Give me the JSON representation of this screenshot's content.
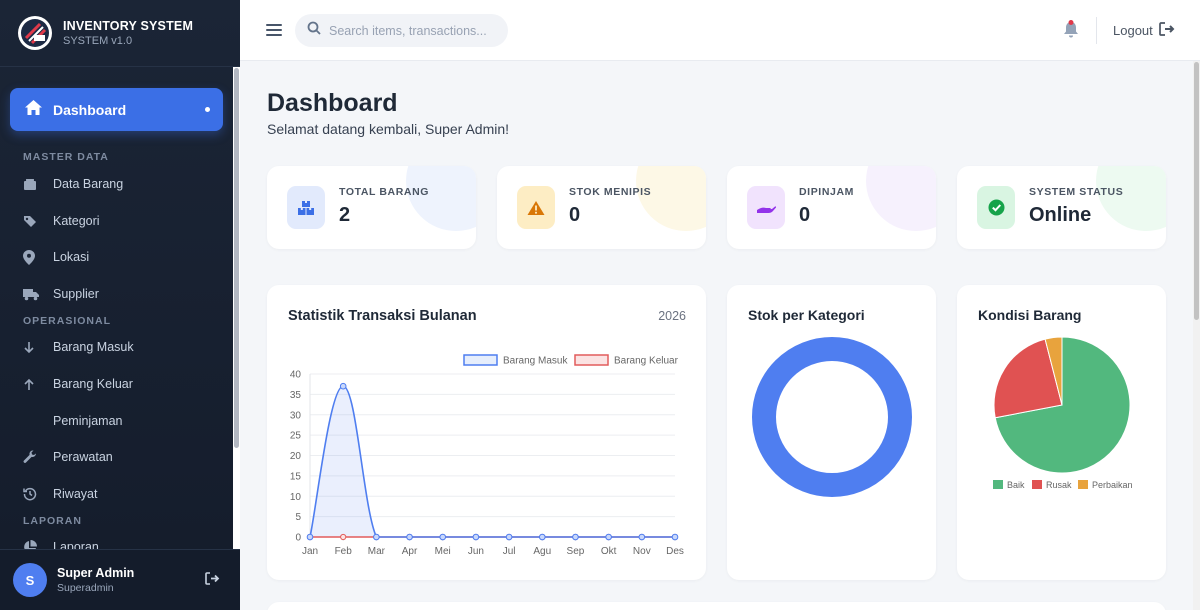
{
  "brand": {
    "title": "INVENTORY SYSTEM",
    "subtitle": "SYSTEM v1.0"
  },
  "sidebar": {
    "active": {
      "label": "Dashboard",
      "icon": "home-icon"
    },
    "sections": [
      {
        "title": "MASTER DATA"
      },
      {
        "title": "OPERASIONAL"
      },
      {
        "title": "LAPORAN"
      }
    ],
    "items": [
      {
        "label": "Data Barang",
        "icon": "box-icon"
      },
      {
        "label": "Kategori",
        "icon": "tags-icon"
      },
      {
        "label": "Lokasi",
        "icon": "map-pin-icon"
      },
      {
        "label": "Supplier",
        "icon": "truck-icon"
      },
      {
        "label": "Barang Masuk",
        "icon": "arrow-down-icon"
      },
      {
        "label": "Barang Keluar",
        "icon": "arrow-up-icon"
      },
      {
        "label": "Peminjaman",
        "icon": "handshake-icon"
      },
      {
        "label": "Perawatan",
        "icon": "wrench-icon"
      },
      {
        "label": "Riwayat",
        "icon": "history-icon"
      },
      {
        "label": "Laporan",
        "icon": "pie-chart-icon"
      }
    ]
  },
  "user": {
    "initial": "S",
    "name": "Super Admin",
    "role": "Superadmin"
  },
  "topbar": {
    "search_placeholder": "Search items, transactions...",
    "logout_label": "Logout"
  },
  "page": {
    "title": "Dashboard",
    "subtitle": "Selamat datang kembali, Super Admin!"
  },
  "stats": [
    {
      "label": "TOTAL BARANG",
      "value": "2",
      "icon": "boxes-icon",
      "color": "#3b6fe6"
    },
    {
      "label": "STOK MENIPIS",
      "value": "0",
      "icon": "warning-icon",
      "color": "#d97706"
    },
    {
      "label": "DIPINJAM",
      "value": "0",
      "icon": "hand-icon",
      "color": "#9333ea"
    },
    {
      "label": "SYSTEM STATUS",
      "value": "Online",
      "icon": "check-circle-icon",
      "color": "#16a34a"
    }
  ],
  "charts": {
    "monthly_title": "Statistik Transaksi Bulanan",
    "monthly_year": "2026",
    "category_title": "Stok per Kategori",
    "condition_title": "Kondisi Barang"
  },
  "chart_data": [
    {
      "type": "line",
      "title": "Statistik Transaksi Bulanan",
      "categories": [
        "Jan",
        "Feb",
        "Mar",
        "Apr",
        "Mei",
        "Jun",
        "Jul",
        "Agu",
        "Sep",
        "Okt",
        "Nov",
        "Des"
      ],
      "series": [
        {
          "name": "Barang Masuk",
          "values": [
            0,
            37,
            0,
            0,
            0,
            0,
            0,
            0,
            0,
            0,
            0,
            0
          ],
          "color": "#4f7ef0"
        },
        {
          "name": "Barang Keluar",
          "values": [
            0,
            0,
            0,
            0,
            0,
            0,
            0,
            0,
            0,
            0,
            0,
            0
          ],
          "color": "#e25c5c"
        }
      ],
      "ylim": [
        0,
        40
      ],
      "yticks": [
        0,
        5,
        10,
        15,
        20,
        25,
        30,
        35,
        40
      ],
      "grid": true,
      "legend": "top-right"
    },
    {
      "type": "pie",
      "title": "Stok per Kategori",
      "categories": [
        ""
      ],
      "values": [
        1
      ],
      "colors": [
        "#4f7ef0"
      ]
    },
    {
      "type": "pie",
      "title": "Kondisi Barang",
      "categories": [
        "Baik",
        "Rusak",
        "Perbaikan"
      ],
      "values": [
        72,
        24,
        4
      ],
      "colors": [
        "#52b87e",
        "#e05252",
        "#e8a33d"
      ],
      "legend": "bottom"
    }
  ]
}
